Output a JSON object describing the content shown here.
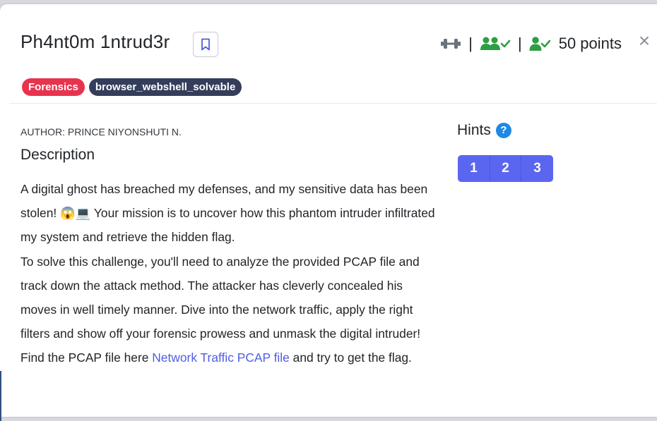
{
  "challenge": {
    "title": "Ph4nt0m 1ntrud3r",
    "points": "50 points",
    "separator": "|",
    "close_symbol": "×",
    "tags": [
      "Forensics",
      "browser_webshell_solvable"
    ],
    "author": "AUTHOR: PRINCE NIYONSHUTI N.",
    "description_heading": "Description",
    "description": {
      "p1_text": "A digital ghost has breached my defenses, and my sensitive data has been stolen!",
      "p1_emojis": "😱💻",
      "p1_rest": " Your mission is to uncover how this phantom intruder infiltrated my system and retrieve the hidden flag.",
      "p2": "To solve this challenge, you'll need to analyze the provided PCAP file and track down the attack method. The attacker has cleverly concealed his moves in well timely manner. Dive into the network traffic, apply the right filters and show off your forensic prowess and unmask the digital intruder!",
      "p3_before": "Find the PCAP file here ",
      "p3_link": "Network Traffic PCAP file",
      "p3_after": " and try to get the flag."
    }
  },
  "hints": {
    "heading": "Hints",
    "help_symbol": "?",
    "buttons": [
      "1",
      "2",
      "3"
    ]
  },
  "icons": {
    "bookmark": "bookmark-icon",
    "difficulty": "dumbbell-icon",
    "solvers": "users-check-icon",
    "solved": "user-check-icon",
    "close": "close-icon"
  },
  "colors": {
    "accent": "#5b66f0",
    "success": "#2e9e44",
    "tag_category": "#e8334e",
    "tag_dark": "#343e5a",
    "link": "#4e5ee4",
    "help": "#1e88e5"
  }
}
